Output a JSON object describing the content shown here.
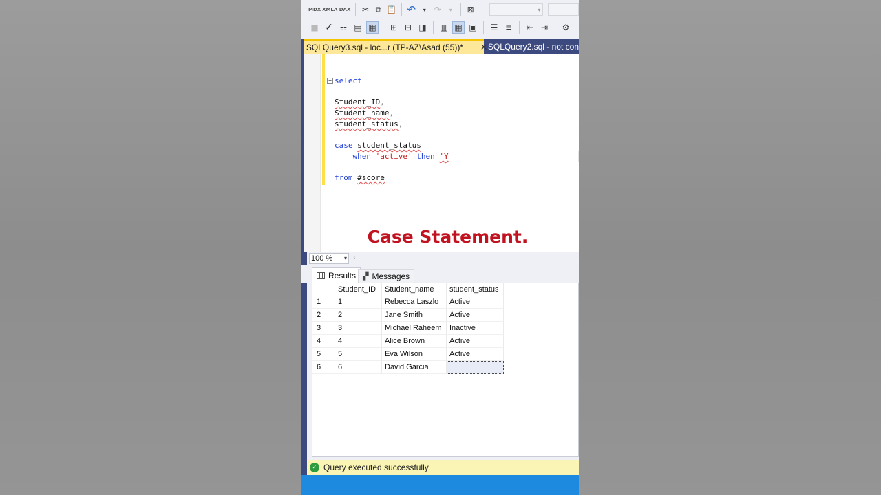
{
  "tabs": {
    "active_label": "SQLQuery3.sql - loc...r (TP-AZ\\Asad (55))*",
    "inactive_label": "SQLQuery2.sql - not con"
  },
  "toolbar": {
    "mdx_label": "MDX",
    "xmla_label": "XMLA",
    "dax_label": "DAX"
  },
  "editor": {
    "line_select": "select",
    "line_id": "Student_ID",
    "line_name": "Student_name",
    "line_status": "student_status",
    "line_case_kw": "case",
    "line_case_col": "student_status",
    "line_when_kw": "when",
    "line_when_str": "'active'",
    "line_then_kw": "then",
    "line_then_str": "'Y",
    "line_from_kw": "from",
    "line_from_tbl": "#score"
  },
  "overlay": {
    "title": "Case Statement."
  },
  "zoom": {
    "value": "100 %"
  },
  "results_tabs": {
    "results": "Results",
    "messages": "Messages"
  },
  "results": {
    "columns": [
      "",
      "Student_ID",
      "Student_name",
      "student_status"
    ],
    "rows": [
      [
        "1",
        "1",
        "Rebecca Laszlo",
        "Active"
      ],
      [
        "2",
        "2",
        "Jane Smith",
        "Active"
      ],
      [
        "3",
        "3",
        "Michael Raheem",
        "Inactive"
      ],
      [
        "4",
        "4",
        "Alice Brown",
        "Active"
      ],
      [
        "5",
        "5",
        "Eva Wilson",
        "Active"
      ],
      [
        "6",
        "6",
        "David Garcia",
        ""
      ]
    ]
  },
  "status": {
    "message": "Query executed successfully."
  },
  "colors": {
    "accent": "#3d4a80",
    "tab_active": "#fde89a",
    "title_red": "#c1121f",
    "status_bg": "#fbf5b5",
    "bottom_blue": "#1d8ae0"
  }
}
